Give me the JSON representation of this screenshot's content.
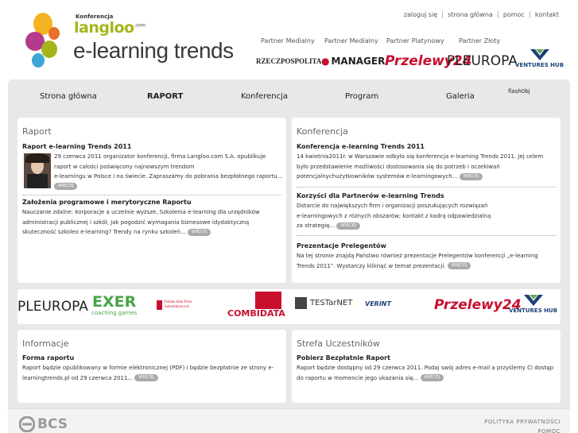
{
  "toplinks": [
    "zaloguj się",
    "strona główna",
    "pomoc",
    "kontakt"
  ],
  "logo": {
    "konferencja": "Konferencja",
    "langloo": "langloo",
    "langloo_com": ".com",
    "brand": "e-learning trends"
  },
  "partners": [
    {
      "label": "Partner Medialny",
      "logo": "RZECZPOSPOLITA"
    },
    {
      "label": "Partner Medialny",
      "logo": "MANAGER"
    },
    {
      "label": "Partner Platynowy",
      "logo": "Przelewy24"
    },
    {
      "label": "Partner Złoty",
      "logo": "PLEUROPA"
    },
    {
      "label": "",
      "logo": "VENTURES HUB"
    }
  ],
  "nav": {
    "items": [
      "Strona główna",
      "RAPORT",
      "Konferencja",
      "Program",
      "Galeria"
    ],
    "flash": "flash0bj"
  },
  "raport": {
    "title": "Raport",
    "a1_title": "Raport e-learning Trends 2011",
    "a1_lines": [
      "29 czerwca 2011 organizator konferencji, firma Langloo.com S.A. opublikuje",
      "raport w całości poświęcony najnowszym trendom",
      "e-learningu w Polsce i na świecie. Zapraszamy do pobrania bezpłatnego raportu..."
    ],
    "a2_title": "Założenia programowe i merytoryczne Raportu",
    "a2_lines": [
      "Nauczanie zdalne: korporacje a uczelnie wyższe, Szkolenia e-learning dla urzędników",
      "administracji publicznej i szkół, Jak pogodzić wymagania biznesowe idydaktyczną",
      "skuteczność szkoleo e-learning? Trendy na rynku szkoleń..."
    ],
    "more": "WIĘCEJ"
  },
  "konferencja": {
    "title": "Konferencja",
    "a1_title": "Konferencja e-learning Trends 2011",
    "a1_lines": [
      "14 kwietnia2011r. w Warszawie odbyła się konferencja e-learning Trends 2011. Jej celem",
      "było przedstawienie możliwości dostosowania się do potrzeb i oczekiwań",
      "potencjalnychużytkowników systemów e-learningowych..."
    ],
    "a2_title": "Korzyści dla Partnerów e-learning Trends",
    "a2_lines": [
      "Dotarcie do największych firm i organizacji poszukujących rozwiązań",
      "e-learningowych z różnych obszarów; kontakt z kadrą odpowiedzialną",
      "za strategię..."
    ],
    "a3_title": "Prezentacje Prelegentów",
    "a3_lines": [
      "Na tej stronie znajdą Państwo również prezentacje Prelegentów konferencji „e-learning",
      "Trends 2011\". Wystarczy kliknąć w temat prezentacji."
    ],
    "more": "WIĘCEJ"
  },
  "logos": [
    "PLEUROPA",
    "EXER",
    "coaching games",
    "Polska Izba Firm Szkoleniowych",
    "COMBIDATA",
    "TESTarNET",
    "VERINT",
    "Przelewy24",
    "VENTURES HUB"
  ],
  "informacje": {
    "title": "Informacje",
    "a1_title": "Forma raportu",
    "a1_lines": [
      "Raport będzie opublikowany w formie elektronicznej (PDF) i będzie bezpłatnie ze strony e-",
      "learningtrends.pl od 29 czerwca 2011..."
    ],
    "more": "WIĘCEJ"
  },
  "strefa": {
    "title": "Strefa Uczestników",
    "a1_title": "Pobierz Bezpłatnie Raport",
    "a1_lines": [
      "Raport będzie dostępny od 29 czerwca 2011. Podaj swój adres e-mail a przyślemy Ci dostęp",
      "do raportu w momencie jego ukazania się..."
    ],
    "more": "WIĘCEJ"
  },
  "footer": {
    "logo": "BCS",
    "links": [
      "POLITYKA PRYWATNOŚCI",
      "POMOC"
    ]
  },
  "colors": {
    "green": "#a6b41a",
    "red": "#c8102e",
    "gray_band": "#e8e8e8"
  }
}
